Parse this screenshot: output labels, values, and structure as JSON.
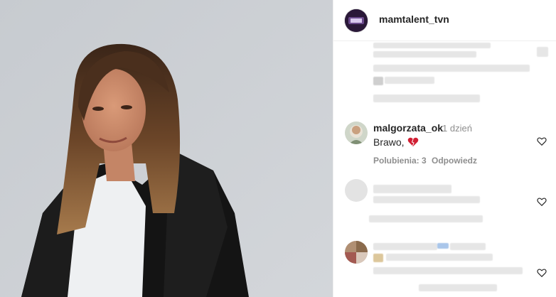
{
  "post": {
    "account": "mamtalent_tvn"
  },
  "comment": {
    "username": "malgorzata_ok",
    "time": "1 dzień",
    "text": "Brawo,",
    "likes": "Polubienia: 3",
    "reply": "Odpowiedz"
  },
  "colors": {
    "heart_emoji": "#d11f33",
    "muted": "#8e8e8e",
    "text": "#262626"
  }
}
